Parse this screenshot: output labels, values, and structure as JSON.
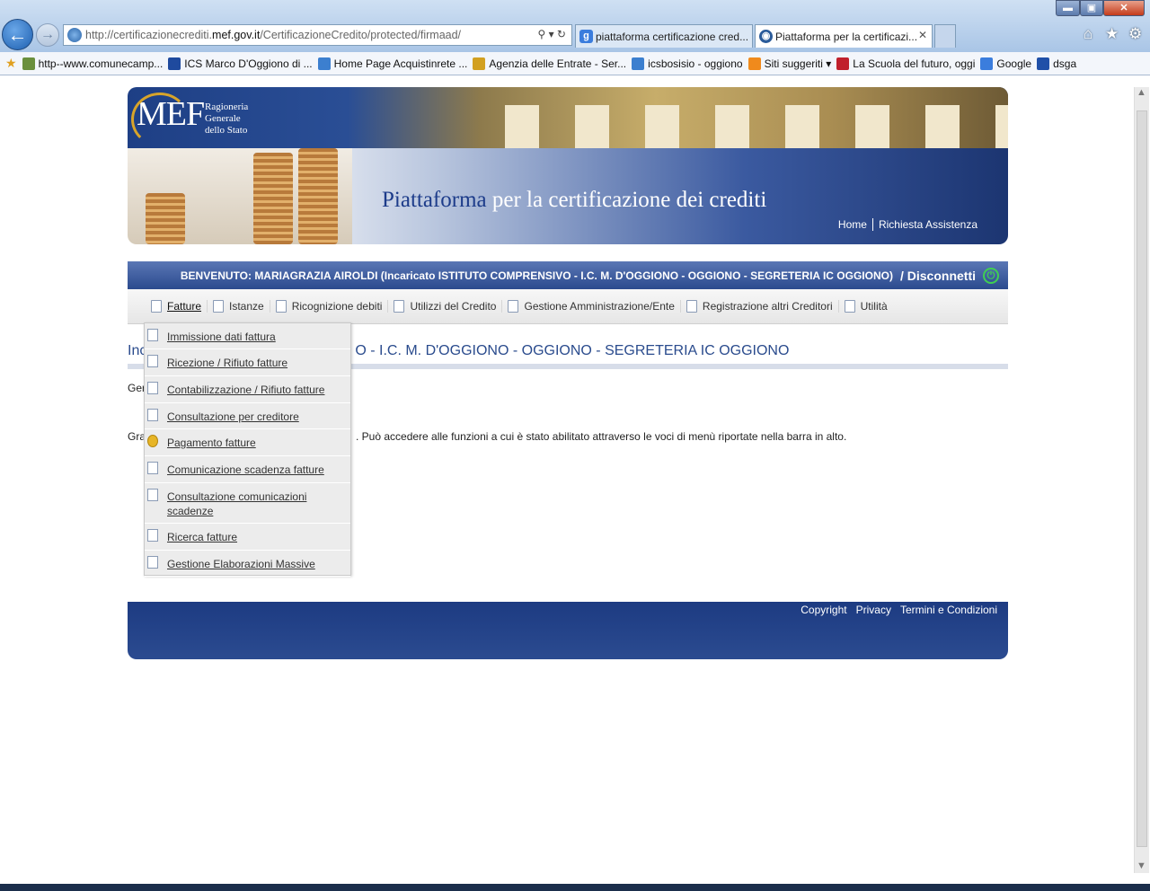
{
  "browser": {
    "url_prefix": "http://certificazionecrediti.",
    "url_domain": "mef.gov.it",
    "url_path": "/CertificazioneCredito/protected/firmaad/",
    "address_tools": "⚲ ▾ ↻",
    "tabs": [
      {
        "label": "piattaforma certificazione cred..."
      },
      {
        "label": "Piattaforma per la certificazi..."
      }
    ],
    "tab_close": "✕",
    "window_min": "▬",
    "window_max": "▣",
    "window_close": "✕",
    "icons": {
      "back": "←",
      "forward": "→",
      "home": "⌂",
      "favorites": "★",
      "tools": "⚙"
    }
  },
  "favorites": [
    {
      "label": "http--www.comunecamp...",
      "icon": "town-icon",
      "color": "#6a8f3c"
    },
    {
      "label": "ICS Marco D'Oggiono di ...",
      "icon": "p-icon",
      "color": "#1f4a9e"
    },
    {
      "label": "Home Page Acquistinrete ...",
      "icon": "ie-icon",
      "color": "#3c7fcf"
    },
    {
      "label": "Agenzia delle Entrate - Ser...",
      "icon": "agency-icon",
      "color": "#d2a020"
    },
    {
      "label": "icsbosisio - oggiono",
      "icon": "ie-icon",
      "color": "#3c7fcf"
    },
    {
      "label": "Siti suggeriti ▾",
      "icon": "suggested-icon",
      "color": "#f08a1c"
    },
    {
      "label": "La Scuola del futuro, oggi",
      "icon": "is-icon",
      "color": "#c0202c"
    },
    {
      "label": "Google",
      "icon": "google-icon",
      "color": "#3b7ddd"
    },
    {
      "label": "dsga",
      "icon": "dsga-icon",
      "color": "#2050a8"
    }
  ],
  "banner": {
    "logo": "MEF",
    "logo_sub": [
      "Ragioneria",
      "Generale",
      "dello Stato"
    ],
    "title_a": "Piattaforma",
    "title_b": " per la certificazione dei crediti",
    "links": [
      "Home",
      "Richiesta Assistenza"
    ]
  },
  "welcome": {
    "text": "BENVENUTO: MARIAGRAZIA AIROLDI (Incaricato ISTITUTO COMPRENSIVO - I.C. M. D'OGGIONO - OGGIONO - SEGRETERIA IC OGGIONO)",
    "disconnect": "/ Disconnetti",
    "power_icon": "⏻"
  },
  "menu": [
    {
      "label": "Fatture",
      "active": true
    },
    {
      "label": "Istanze"
    },
    {
      "label": "Ricognizione debiti"
    },
    {
      "label": "Utilizzi del Credito"
    },
    {
      "label": "Gestione Amministrazione/Ente"
    },
    {
      "label": "Registrazione altri Creditori"
    },
    {
      "label": "Utilità"
    }
  ],
  "dropdown": [
    {
      "label": "Immissione dati fattura"
    },
    {
      "label": "Ricezione / Rifiuto fatture"
    },
    {
      "label": "Contabilizzazione / Rifiuto fatture"
    },
    {
      "label": "Consultazione per creditore"
    },
    {
      "label": "Pagamento fatture"
    },
    {
      "label": "Comunicazione scadenza fatture"
    },
    {
      "label": "Consultazione comunicazioni scadenze"
    },
    {
      "label": "Ricerca fatture"
    },
    {
      "label": "Gestione Elaborazioni Massive"
    }
  ],
  "content": {
    "heading_start": "Inc",
    "heading_end": "O - I.C. M. D'OGGIONO - OGGIONO - SEGRETERIA IC OGGIONO",
    "ger": "Ger",
    "gra": "Gra",
    "gra_tail": ". Può accedere alle funzioni a cui è stato abilitato attraverso le voci di menù riportate nella barra in alto."
  },
  "footer": {
    "links": [
      "Copyright",
      "Privacy",
      "Termini e Condizioni"
    ]
  }
}
